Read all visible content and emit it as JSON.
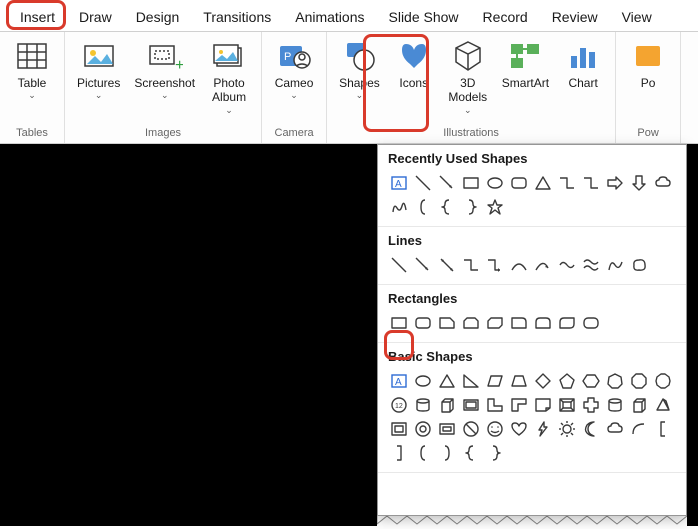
{
  "tabs": [
    "Insert",
    "Draw",
    "Design",
    "Transitions",
    "Animations",
    "Slide Show",
    "Record",
    "Review",
    "View"
  ],
  "active_tab": 0,
  "ribbon_groups": [
    {
      "label": "Tables",
      "buttons": [
        {
          "label": "Table",
          "caret": true,
          "icon": "table"
        }
      ]
    },
    {
      "label": "Images",
      "buttons": [
        {
          "label": "Pictures",
          "caret": true,
          "icon": "pictures"
        },
        {
          "label": "Screenshot",
          "caret": true,
          "icon": "screenshot"
        },
        {
          "label": "Photo\nAlbum",
          "caret": true,
          "icon": "album"
        }
      ]
    },
    {
      "label": "Camera",
      "buttons": [
        {
          "label": "Cameo",
          "caret": true,
          "icon": "cameo"
        }
      ]
    },
    {
      "label": "Illustrations",
      "buttons": [
        {
          "label": "Shapes",
          "caret": true,
          "icon": "shapes"
        },
        {
          "label": "Icons",
          "caret": false,
          "icon": "icons"
        },
        {
          "label": "3D\nModels",
          "caret": true,
          "icon": "models3d"
        },
        {
          "label": "SmartArt",
          "caret": false,
          "icon": "smartart"
        },
        {
          "label": "Chart",
          "caret": false,
          "icon": "chart"
        }
      ]
    },
    {
      "label": "Pow",
      "buttons": [
        {
          "label": "Po",
          "caret": false,
          "icon": "power"
        }
      ]
    }
  ],
  "dropdown": {
    "sections": [
      {
        "heading": "Recently Used Shapes",
        "shapes": [
          "textbox",
          "line",
          "line-arrow",
          "rect",
          "oval",
          "round-rect",
          "triangle",
          "connector",
          "elbow",
          "arrow-right",
          "arrow-down",
          "cloud",
          "scribble",
          "brace-l",
          "curly-l",
          "curly-r",
          "star"
        ]
      },
      {
        "heading": "Lines",
        "shapes": [
          "line",
          "line-arrow",
          "line-double",
          "elbow",
          "elbow-arrow",
          "curve",
          "curve-arrow",
          "wave",
          "wave2",
          "freeform",
          "blob"
        ]
      },
      {
        "heading": "Rectangles",
        "shapes": [
          "rect",
          "round-rect",
          "snip1",
          "snip2",
          "snip-diag",
          "round1",
          "round2",
          "round-diag",
          "round-all"
        ]
      },
      {
        "heading": "Basic Shapes",
        "shapes": [
          "textbox",
          "oval",
          "triangle",
          "rtriangle",
          "parallelogram",
          "trapezoid",
          "diamond",
          "pentagon",
          "hexagon",
          "heptagon",
          "octagon",
          "decagon",
          "circle12",
          "cylinder",
          "cube",
          "bevel",
          "lshape",
          "lshape2",
          "folded",
          "frame2",
          "plus",
          "can",
          "cube2",
          "prism",
          "frame",
          "donut",
          "block",
          "no",
          "smiley",
          "heart",
          "lightning",
          "sun",
          "moon",
          "cloud",
          "arc",
          "bracket-l",
          "bracket-r",
          "brace-l",
          "brace-r",
          "curly-l",
          "curly-r"
        ]
      }
    ]
  },
  "highlights": [
    {
      "name": "insert-tab-highlight"
    },
    {
      "name": "shapes-button-highlight"
    },
    {
      "name": "rectangle-shape-highlight"
    }
  ]
}
